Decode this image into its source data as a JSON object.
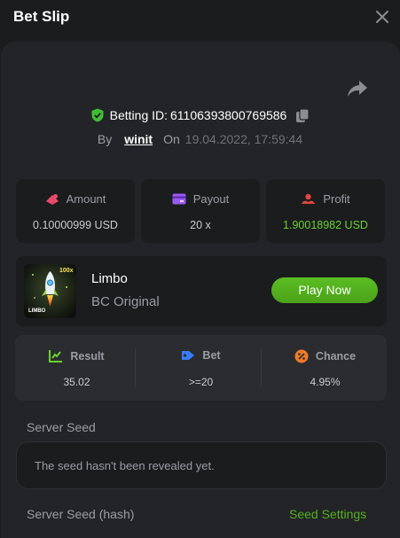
{
  "header": {
    "title": "Bet Slip"
  },
  "bet": {
    "id_label": "Betting ID:",
    "id_value": "61106393800769586",
    "by_label": "By",
    "username": "winit",
    "on_label": "On",
    "datetime": "19.04.2022, 17:59:44"
  },
  "stats": [
    {
      "label": "Amount",
      "value": "0.10000999 USD",
      "icon": "amount-icon",
      "color": "#e94a6a"
    },
    {
      "label": "Payout",
      "value": "20 x",
      "icon": "payout-icon",
      "color": "#9b59f5"
    },
    {
      "label": "Profit",
      "value": "1.90018982 USD",
      "icon": "profit-icon",
      "color": "#e0473f",
      "value_color": "#6ad22f"
    }
  ],
  "game": {
    "name": "Limbo",
    "subtitle": "BC Original",
    "play_label": "Play Now",
    "thumb_text": "LIMBO",
    "thumb_badge": "100x"
  },
  "result": [
    {
      "label": "Result",
      "value": "35.02",
      "icon": "result-icon",
      "color": "#6ad22f"
    },
    {
      "label": "Bet",
      "value": ">=20",
      "icon": "bet-tag-icon",
      "color": "#3a7cf5"
    },
    {
      "label": "Chance",
      "value": "4.95%",
      "icon": "chance-icon",
      "color": "#f07b25"
    }
  ],
  "seed": {
    "server_seed_label": "Server Seed",
    "server_seed_text": "The seed hasn't been revealed yet.",
    "server_seed_hash_label": "Server Seed (hash)",
    "seed_settings_label": "Seed Settings"
  },
  "colors": {
    "accent_green": "#55b120",
    "background": "#1b1c1e",
    "panel": "#232427"
  }
}
